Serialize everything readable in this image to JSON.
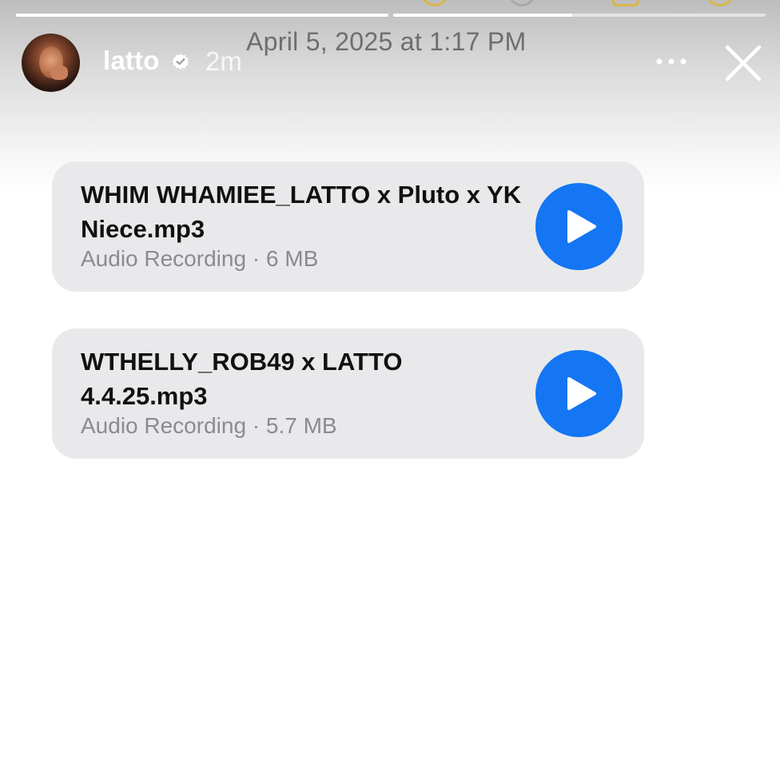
{
  "story_header": {
    "username": "latto",
    "time_ago": "2m",
    "timestamp": "April 5, 2025 at 1:17 PM",
    "icons": {
      "verified": "verified-badge-icon",
      "more": "more-options-icon",
      "close": "close-icon"
    },
    "progress": [
      1.0,
      0.48
    ]
  },
  "files": [
    {
      "name": "WHIM WHAMIEE_LATTO x Pluto x YK Niece.mp3",
      "meta": "Audio Recording · 6 MB",
      "icon": "play-icon"
    },
    {
      "name": "WTHELLY_ROB49 x LATTO 4.4.25.mp3",
      "meta": "Audio Recording · 5.7 MB",
      "icon": "play-icon"
    }
  ],
  "colors": {
    "play_button": "#1476f2",
    "card_background": "#e9e9eb",
    "meta_text": "#8b8b8f"
  }
}
